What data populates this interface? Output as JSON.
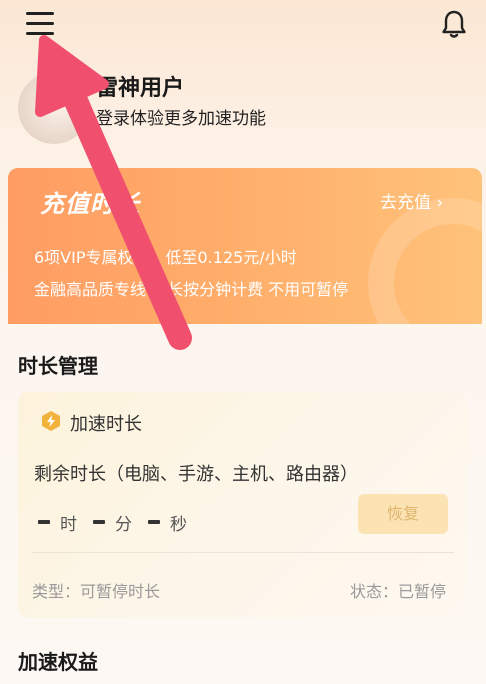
{
  "profile": {
    "username": "雷神用户",
    "login_tip": "登录体验更多加速功能"
  },
  "recharge": {
    "title": "充值时长",
    "link": "去充值 ›",
    "line1": "6项VIP专属权益，低至0.125元/小时",
    "line2": "金融高品质专线 时长按分钟计费 不用可暂停"
  },
  "duration_section": {
    "title": "时长管理",
    "card": {
      "title": "加速时长",
      "remain_label": "剩余时长（电脑、手游、主机、路由器）",
      "units": [
        "时",
        "分",
        "秒"
      ],
      "restore_button": "恢复",
      "type_text": "类型：可暂停时长",
      "status_text": "状态：已暂停"
    }
  },
  "benefits_section": {
    "title": "加速权益"
  },
  "colors": {
    "accent_orange": "#ff9c63",
    "arrow_red": "#f0506e",
    "button_bg": "#fbe3b4"
  },
  "icons": {
    "menu": "menu-icon",
    "notification": "bell-icon",
    "duration": "lightning-hexagon-icon"
  }
}
